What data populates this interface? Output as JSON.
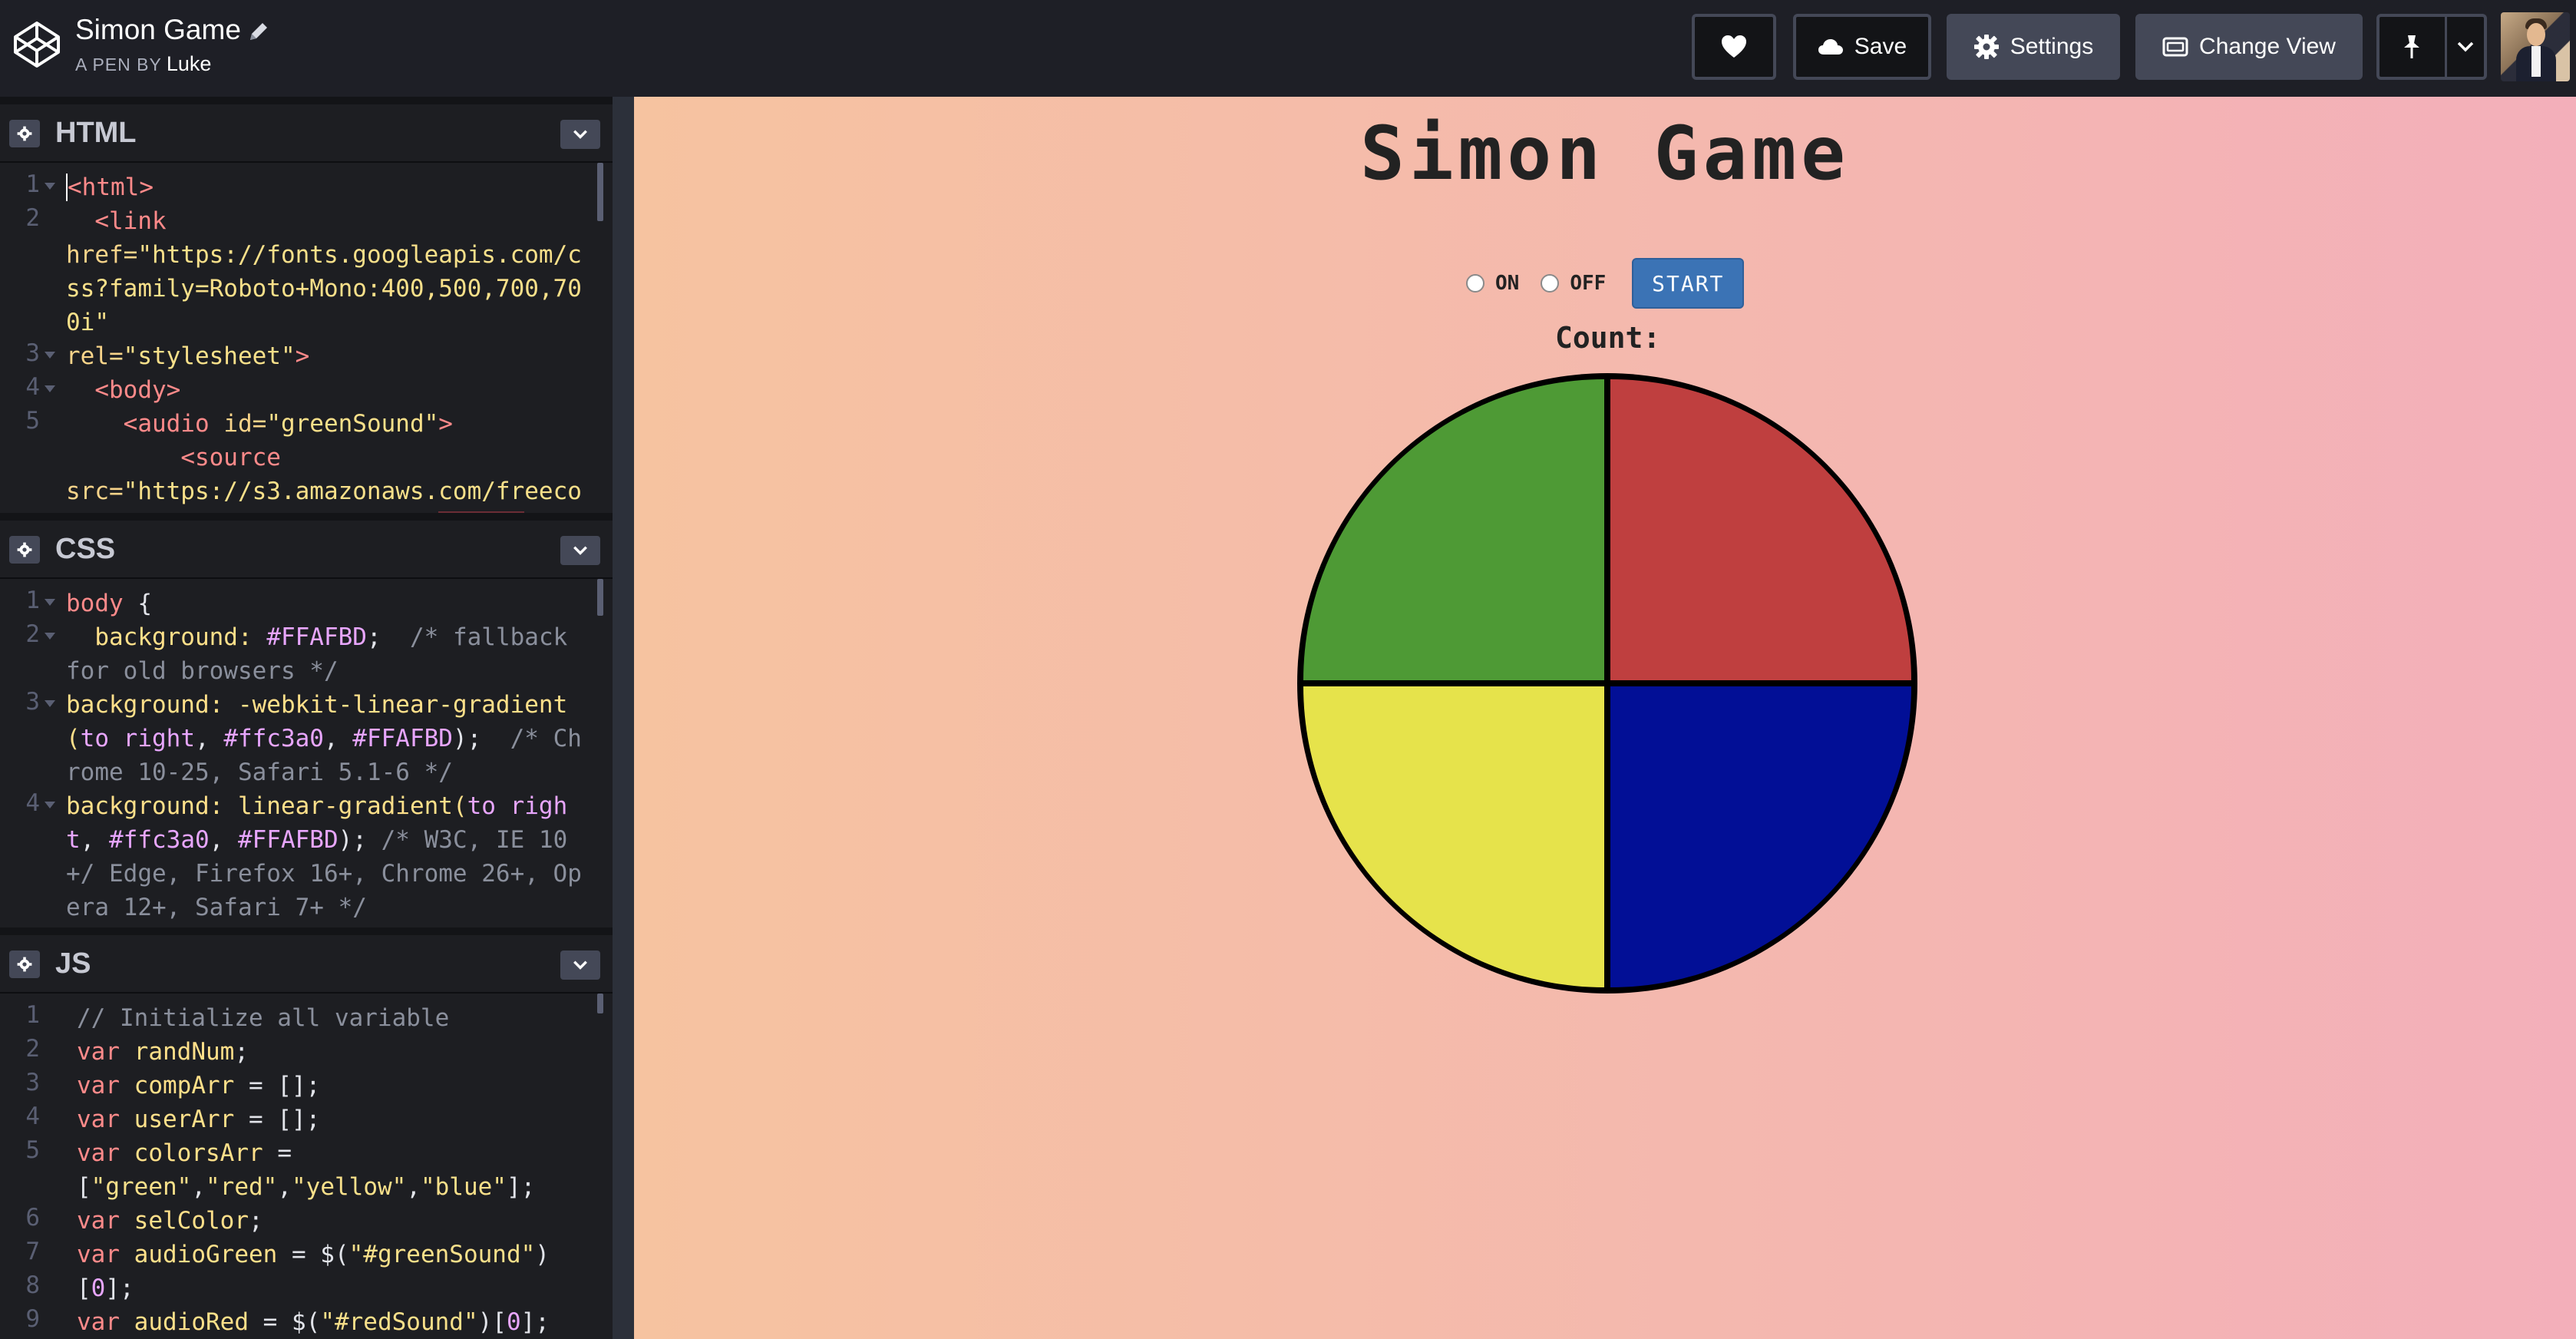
{
  "app": {
    "pen_title": "Simon Game",
    "pen_by_label": "A PEN BY",
    "author": "Luke"
  },
  "toolbar": {
    "heart_icon": "heart-icon",
    "save_label": "Save",
    "settings_label": "Settings",
    "change_view_label": "Change View",
    "pin_icon": "pin-icon"
  },
  "editors": {
    "html": {
      "title": "HTML",
      "line_numbers": [
        "1",
        "2",
        "3",
        "4",
        "5"
      ]
    },
    "css": {
      "title": "CSS",
      "line_numbers": [
        "1",
        "2",
        "3",
        "4"
      ]
    },
    "js": {
      "title": "JS",
      "line_numbers": [
        "1",
        "2",
        "3",
        "4",
        "5",
        "6",
        "7",
        "8",
        "9"
      ]
    }
  },
  "preview": {
    "title": "Simon Game",
    "on_label": "ON",
    "off_label": "OFF",
    "start_label": "START",
    "count_label": "Count:",
    "colors": {
      "green": "#4e9a35",
      "red": "#bf3f3f",
      "yellow": "#e6e34b",
      "blue": "#020f96",
      "gradient_start": "#f6c3a0",
      "gradient_end": "#f3afba"
    }
  }
}
